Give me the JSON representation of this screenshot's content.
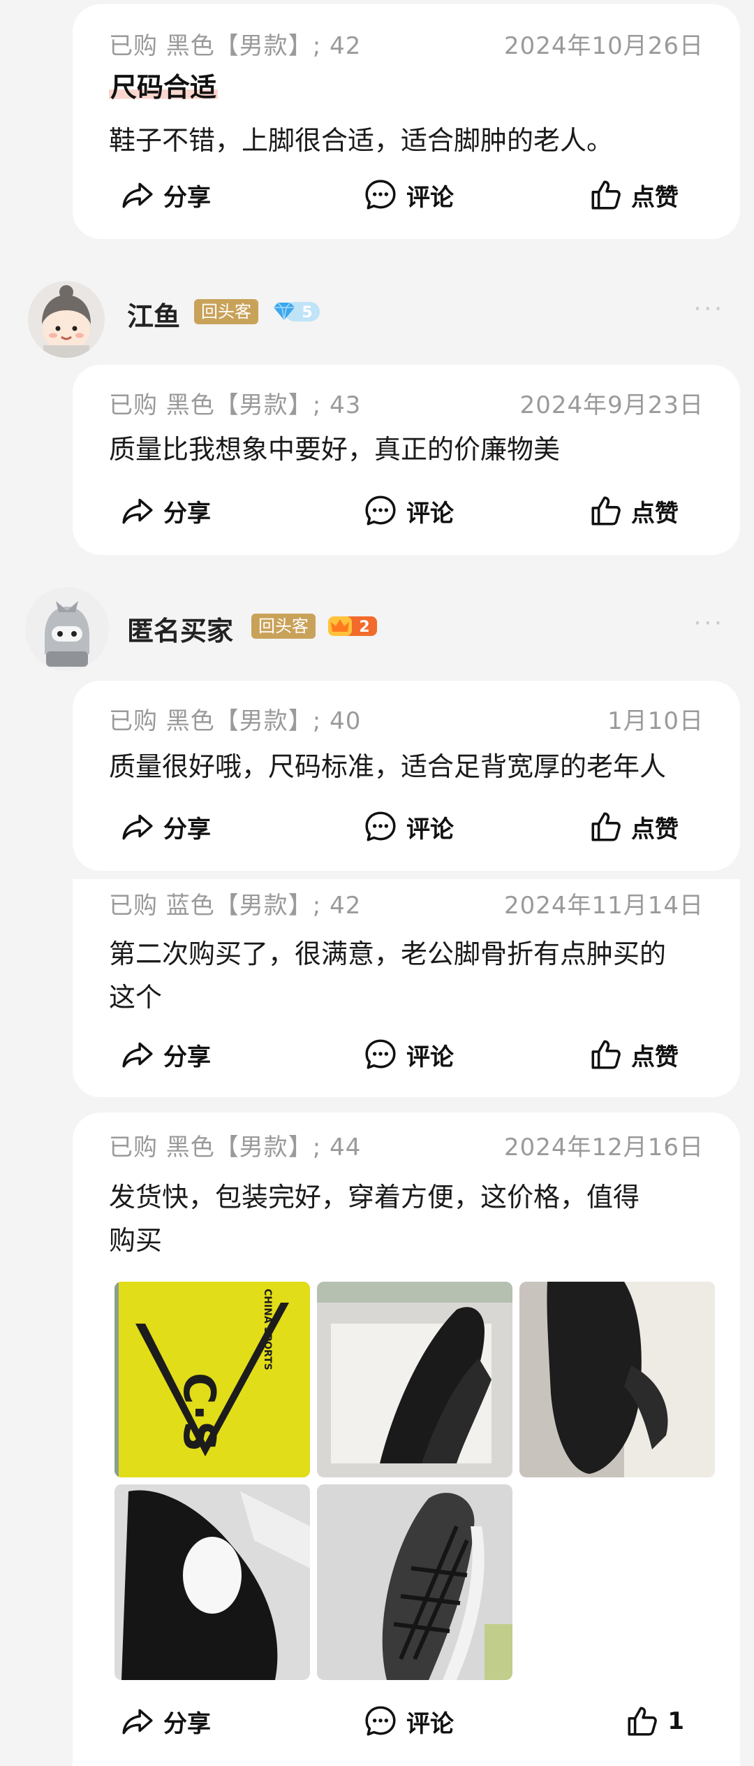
{
  "reviews": [
    {
      "spec": "已购 黑色【男款】; 42",
      "date": "2024年10月26日",
      "title": "尺码合适",
      "text": "鞋子不错，上脚很合适，适合脚肿的老人。"
    },
    {
      "spec": "已购 黑色【男款】; 43",
      "date": "2024年9月23日",
      "text": "质量比我想象中要好，真正的价廉物美"
    },
    {
      "spec": "已购 黑色【男款】; 40",
      "date": "1月10日",
      "text": "质量很好哦，尺码标准，适合足背宽厚的老年人"
    },
    {
      "spec": "已购 蓝色【男款】; 42",
      "date": "2024年11月14日",
      "text_line1": "第二次购买了，很满意，老公脚骨折有点肿买的",
      "text_line2": "这个"
    },
    {
      "spec": "已购 黑色【男款】; 44",
      "date": "2024年12月16日",
      "text_line1": "发货快，包装完好，穿着方便，这价格，值得",
      "text_line2": "购买",
      "like_count": "1"
    }
  ],
  "users": [
    {
      "name": "江鱼",
      "badge": "回头客",
      "level": "5",
      "level_icon": "diamond-icon",
      "level_color": "#4fb4f0"
    },
    {
      "name": "匿名买家",
      "badge": "回头客",
      "level": "2",
      "level_icon": "crown-icon",
      "level_color": "#f26b2a"
    }
  ],
  "actions": {
    "share": "分享",
    "comment": "评论",
    "like": "点赞"
  },
  "photo_label": "C·S",
  "photo_brand": "CHINA SPORTS",
  "more_label": "···"
}
